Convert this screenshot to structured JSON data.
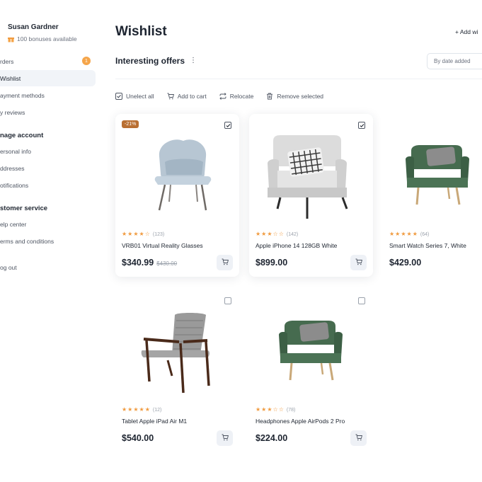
{
  "user": {
    "name": "Susan Gardner",
    "bonus": "100 bonuses available"
  },
  "sidebar": {
    "orders": "rders",
    "orders_badge": "1",
    "wishlist": "Wishlist",
    "payment": "ayment methods",
    "reviews": "y reviews",
    "manage_head": "nage account",
    "personal": "ersonal info",
    "addresses": "ddresses",
    "notifications": "otifications",
    "service_head": "stomer service",
    "help": "elp center",
    "terms": "erms and conditions",
    "logout": "og out"
  },
  "header": {
    "title": "Wishlist",
    "add": "+ Add wi",
    "subtitle": "Interesting offers",
    "sort": "By date added"
  },
  "toolbar": {
    "unselect": "Unelect all",
    "cart": "Add to cart",
    "relocate": "Relocate",
    "remove": "Remove selected"
  },
  "products": [
    {
      "name": "VRB01 Virtual Reality Glasses",
      "stars": "★★★★☆",
      "count": "(123)",
      "price": "$340.99",
      "old_price": "$430.00",
      "discount": "-21%",
      "checked": true,
      "image": "blue-armchair"
    },
    {
      "name": "Apple iPhone 14 128GB White",
      "stars": "★★★☆☆",
      "count": "(142)",
      "price": "$899.00",
      "checked": true,
      "image": "white-armchair"
    },
    {
      "name": "Smart Watch Series 7, White",
      "stars": "★★★★★",
      "count": "(64)",
      "price": "$429.00",
      "checked": false,
      "image": "green-armchair"
    },
    {
      "name": "Tablet Apple iPad Air M1",
      "stars": "★★★★★",
      "count": "(12)",
      "price": "$540.00",
      "checked": false,
      "image": "wood-armchair"
    },
    {
      "name": "Headphones Apple AirPods 2 Pro",
      "stars": "★★★☆☆",
      "count": "(78)",
      "price": "$224.00",
      "checked": false,
      "image": "green-armchair"
    }
  ],
  "colors": {
    "accent": "#f09a3e",
    "badge": "#f5a54a",
    "discount": "#b96f32"
  }
}
